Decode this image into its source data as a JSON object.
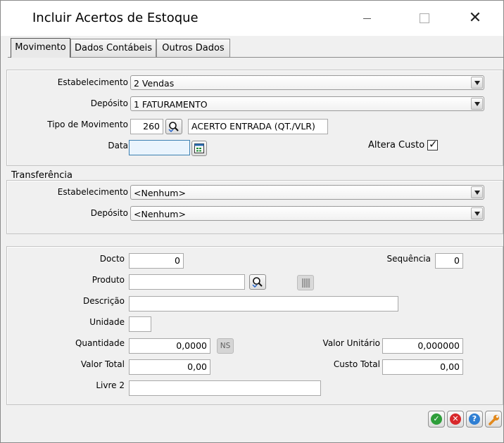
{
  "window": {
    "title": "Incluir Acertos de Estoque"
  },
  "tabs": [
    {
      "label": "Movimento",
      "active": true
    },
    {
      "label": "Dados Contábeis",
      "active": false
    },
    {
      "label": "Outros Dados",
      "active": false
    }
  ],
  "movimento": {
    "estabelecimento": {
      "label": "Estabelecimento",
      "value": "2 Vendas"
    },
    "deposito": {
      "label": "Depósito",
      "value": "1 FATURAMENTO"
    },
    "tipo_movimento": {
      "label": "Tipo de Movimento",
      "code": "260",
      "description": "ACERTO ENTRADA (QT./VLR)"
    },
    "data": {
      "label": "Data",
      "value": ""
    },
    "altera_custo": {
      "label": "Altera Custo",
      "checked": true
    }
  },
  "transferencia": {
    "title": "Transferência",
    "estabelecimento": {
      "label": "Estabelecimento",
      "value": "<Nenhum>"
    },
    "deposito": {
      "label": "Depósito",
      "value": "<Nenhum>"
    }
  },
  "item": {
    "docto": {
      "label": "Docto",
      "value": "0"
    },
    "sequencia": {
      "label": "Sequência",
      "value": "0"
    },
    "produto": {
      "label": "Produto",
      "value": ""
    },
    "descricao": {
      "label": "Descrição",
      "value": ""
    },
    "unidade": {
      "label": "Unidade",
      "value": ""
    },
    "quantidade": {
      "label": "Quantidade",
      "value": "0,0000",
      "ns_label": "NS"
    },
    "valor_unitario": {
      "label": "Valor Unitário",
      "value": "0,000000"
    },
    "valor_total": {
      "label": "Valor Total",
      "value": "0,00"
    },
    "custo_total": {
      "label": "Custo Total",
      "value": "0,00"
    },
    "livre2": {
      "label": "Livre 2",
      "value": ""
    }
  },
  "icons": {
    "ok": "check-icon",
    "cancel": "cancel-icon",
    "help": "help-icon",
    "tools": "wrench-icon"
  },
  "colors": {
    "ok": "#2e9e3a",
    "cancel": "#d8282b",
    "help": "#2f7fd3",
    "tools": "#e2891d"
  }
}
